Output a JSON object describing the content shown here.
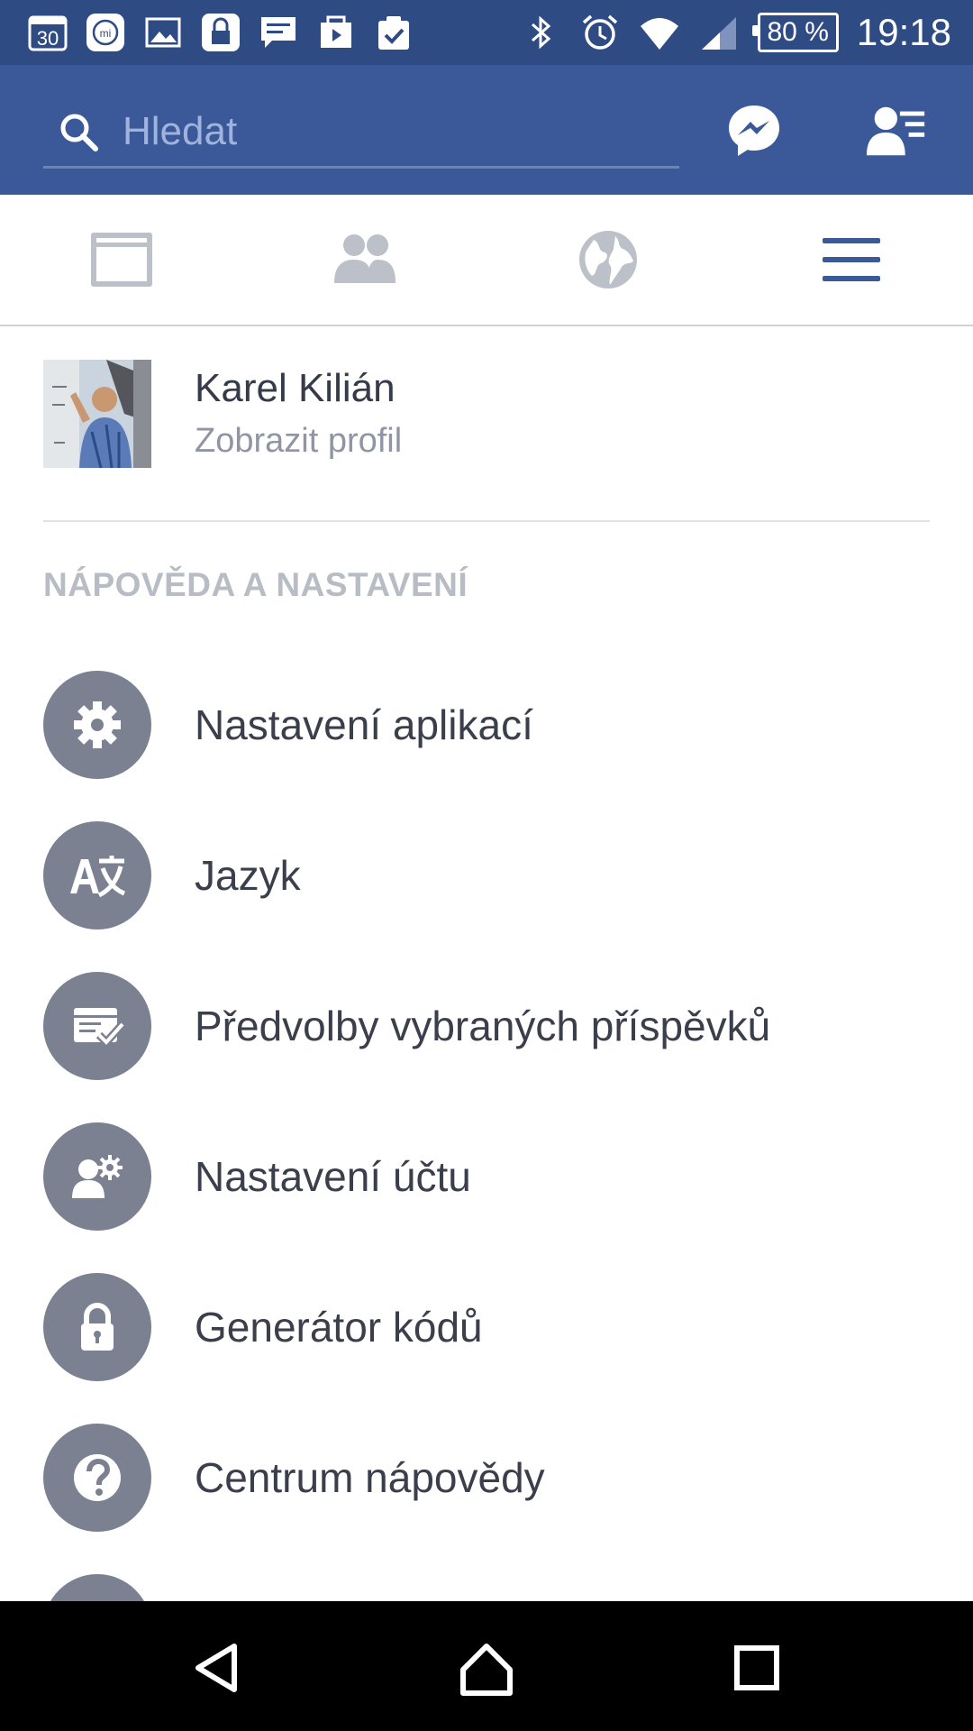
{
  "status_bar": {
    "notification_icons": [
      "calendar-icon",
      "mi-icon",
      "image-icon",
      "lock-app-icon",
      "message-icon",
      "video-share-icon",
      "clipboard-check-icon"
    ],
    "calendar_day": "30",
    "mi_badge": "mi",
    "system_icons": [
      "bluetooth-icon",
      "alarm-icon",
      "wifi-icon",
      "signal-icon"
    ],
    "battery": "80 %",
    "time": "19:18"
  },
  "header": {
    "search_placeholder": "Hledat",
    "messenger_icon": "messenger-icon",
    "friend_requests_icon": "friend-requests-icon"
  },
  "tabs": [
    {
      "name": "news-feed",
      "icon": "news-feed-icon",
      "active": false
    },
    {
      "name": "friends",
      "icon": "friends-icon",
      "active": false
    },
    {
      "name": "notifications",
      "icon": "globe-icon",
      "active": false
    },
    {
      "name": "menu",
      "icon": "hamburger-icon",
      "active": true
    }
  ],
  "profile": {
    "name": "Karel Kilián",
    "subtitle": "Zobrazit profil"
  },
  "section_title": "NÁPOVĚDA A NASTAVENÍ",
  "menu_items": [
    {
      "label": "Nastavení aplikací",
      "icon": "gear-icon"
    },
    {
      "label": "Jazyk",
      "icon": "translate-icon"
    },
    {
      "label": "Předvolby vybraných příspěvků",
      "icon": "feed-preferences-icon"
    },
    {
      "label": "Nastavení účtu",
      "icon": "account-settings-icon"
    },
    {
      "label": "Generátor kódů",
      "icon": "lock-icon"
    },
    {
      "label": "Centrum nápovědy",
      "icon": "help-icon"
    }
  ],
  "nav_bar": {
    "back_icon": "back-icon",
    "home_icon": "home-icon",
    "recent_icon": "recent-apps-icon"
  },
  "colors": {
    "header_blue": "#3b5998",
    "status_blue": "#2f4b83",
    "icon_gray": "#7b8190",
    "active_tab": "#3b5998"
  }
}
